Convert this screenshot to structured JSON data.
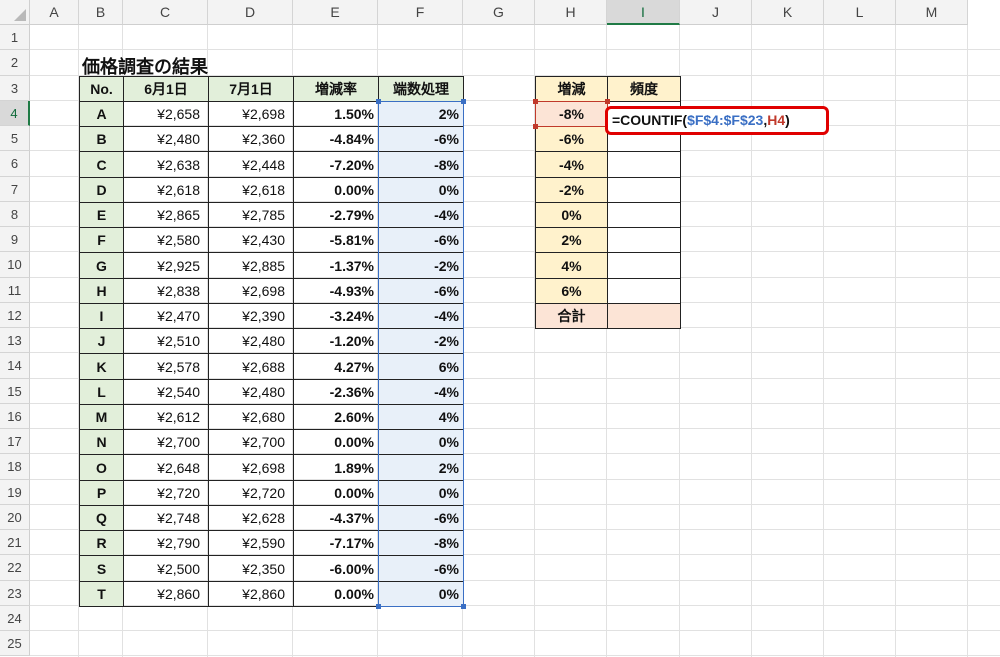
{
  "columns": [
    "A",
    "B",
    "C",
    "D",
    "E",
    "F",
    "G",
    "H",
    "I",
    "J",
    "K",
    "L",
    "M"
  ],
  "rows": [
    "1",
    "2",
    "3",
    "4",
    "5",
    "6",
    "7",
    "8",
    "9",
    "10",
    "11",
    "12",
    "13",
    "14",
    "15",
    "16",
    "17",
    "18",
    "19",
    "20",
    "21",
    "22",
    "23",
    "24",
    "25"
  ],
  "title": "価格調査の結果",
  "table": {
    "headers": [
      "No.",
      "6月1日",
      "7月1日",
      "増減率",
      "端数処理"
    ],
    "rows": [
      [
        "A",
        "¥2,658",
        "¥2,698",
        "1.50%",
        "2%"
      ],
      [
        "B",
        "¥2,480",
        "¥2,360",
        "-4.84%",
        "-6%"
      ],
      [
        "C",
        "¥2,638",
        "¥2,448",
        "-7.20%",
        "-8%"
      ],
      [
        "D",
        "¥2,618",
        "¥2,618",
        "0.00%",
        "0%"
      ],
      [
        "E",
        "¥2,865",
        "¥2,785",
        "-2.79%",
        "-4%"
      ],
      [
        "F",
        "¥2,580",
        "¥2,430",
        "-5.81%",
        "-6%"
      ],
      [
        "G",
        "¥2,925",
        "¥2,885",
        "-1.37%",
        "-2%"
      ],
      [
        "H",
        "¥2,838",
        "¥2,698",
        "-4.93%",
        "-6%"
      ],
      [
        "I",
        "¥2,470",
        "¥2,390",
        "-3.24%",
        "-4%"
      ],
      [
        "J",
        "¥2,510",
        "¥2,480",
        "-1.20%",
        "-2%"
      ],
      [
        "K",
        "¥2,578",
        "¥2,688",
        "4.27%",
        "6%"
      ],
      [
        "L",
        "¥2,540",
        "¥2,480",
        "-2.36%",
        "-4%"
      ],
      [
        "M",
        "¥2,612",
        "¥2,680",
        "2.60%",
        "4%"
      ],
      [
        "N",
        "¥2,700",
        "¥2,700",
        "0.00%",
        "0%"
      ],
      [
        "O",
        "¥2,648",
        "¥2,698",
        "1.89%",
        "2%"
      ],
      [
        "P",
        "¥2,720",
        "¥2,720",
        "0.00%",
        "0%"
      ],
      [
        "Q",
        "¥2,748",
        "¥2,628",
        "-4.37%",
        "-6%"
      ],
      [
        "R",
        "¥2,790",
        "¥2,590",
        "-7.17%",
        "-8%"
      ],
      [
        "S",
        "¥2,500",
        "¥2,350",
        "-6.00%",
        "-6%"
      ],
      [
        "T",
        "¥2,860",
        "¥2,860",
        "0.00%",
        "0%"
      ]
    ]
  },
  "freq": {
    "headers": [
      "増減",
      "頻度"
    ],
    "bins": [
      "-8%",
      "-6%",
      "-4%",
      "-2%",
      "0%",
      "2%",
      "4%",
      "6%"
    ],
    "total_label": "合計"
  },
  "formula": {
    "prefix": "=COUNTIF(",
    "ref1": "$F$4:$F$23",
    "sep": ",",
    "ref2": "H4",
    "suffix": ")"
  },
  "active_cell": "I4",
  "colors": {
    "header_green": "#e2efda",
    "highlight_blue": "#e8f0f9",
    "bin_yellow": "#fff2cc",
    "total_pink": "#fce4d6",
    "formula_border": "#e00000"
  }
}
